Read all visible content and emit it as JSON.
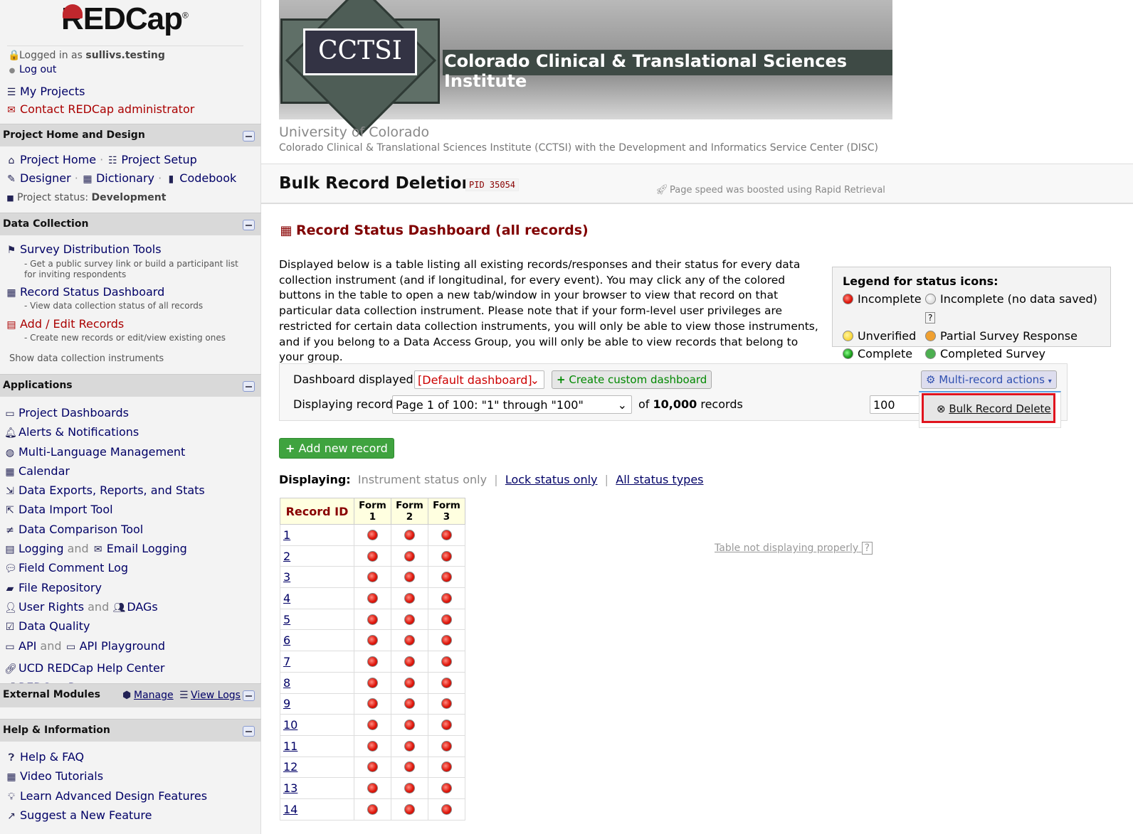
{
  "sidebar": {
    "logo": "REDCap",
    "logo_mark": "®",
    "logged_in_prefix": "Logged in as",
    "username": "sullivs.testing",
    "logout": "Log out",
    "my_projects": "My Projects",
    "contact": "Contact REDCap administrator",
    "sections": {
      "design": {
        "title": "Project Home and Design",
        "project_home": "Project Home",
        "project_setup": "Project Setup",
        "designer": "Designer",
        "dictionary": "Dictionary",
        "codebook": "Codebook",
        "status_label": "Project status:",
        "status_value": "Development"
      },
      "collection": {
        "title": "Data Collection",
        "survey": "Survey Distribution Tools",
        "survey_desc": "- Get a public survey link or build a participant list for inviting respondents",
        "rsd": "Record Status Dashboard",
        "rsd_desc": "- View data collection status of all records",
        "add_edit": "Add / Edit Records",
        "add_edit_desc": "- Create new records or edit/view existing ones",
        "show_instruments": "Show data collection instruments"
      },
      "applications": {
        "title": "Applications",
        "items": [
          "Project Dashboards",
          "Alerts & Notifications",
          "Multi-Language Management",
          "Calendar",
          "Data Exports, Reports, and Stats",
          "Data Import Tool",
          "Data Comparison Tool"
        ],
        "logging": "Logging",
        "and": "and",
        "email_logging": "Email Logging",
        "field_comment": "Field Comment Log",
        "file_repo": "File Repository",
        "user_rights": "User Rights",
        "dags": "DAGs",
        "data_quality": "Data Quality",
        "api": "API",
        "api_playground": "API Playground",
        "help_center": "UCD REDCap Help Center",
        "resources": "REDCap Resources"
      },
      "external": {
        "title": "External Modules",
        "manage": "Manage",
        "view_logs": "View Logs"
      },
      "help": {
        "title": "Help & Information",
        "items": [
          "Help & FAQ",
          "Video Tutorials",
          "Learn Advanced Design Features",
          "Suggest a New Feature"
        ]
      }
    }
  },
  "banner": {
    "acronym": "CCTSI",
    "name": "Colorado Clinical & Translational Sciences Institute",
    "institution": "University of Colorado",
    "subtitle": "Colorado Clinical & Translational Sciences Institute (CCTSI) with the Development and Informatics Service Center (DISC)"
  },
  "header": {
    "title": "Bulk Record Deletion",
    "pid": "PID 35054",
    "speed_note": "Page speed was boosted using Rapid Retrieval"
  },
  "main": {
    "dashboard_title": "Record Status Dashboard (all records)",
    "intro": "Displayed below is a table listing all existing records/responses and their status for every data collection instrument (and if longitudinal, for every event). You may click any of the colored buttons in the table to open a new tab/window in your browser to view that record on that particular data collection instrument. Please note that if your form-level user privileges are restricted for certain data collection instruments, you will only be able to view those instruments, and if you belong to a Data Access Group, you will only be able to view records that belong to your group.",
    "legend": {
      "title": "Legend for status icons:",
      "incomplete": "Incomplete",
      "incomplete_nodata": "Incomplete (no data saved)",
      "help": "?",
      "unverified": "Unverified",
      "partial": "Partial Survey Response",
      "complete": "Complete",
      "completed_survey": "Completed Survey Response"
    },
    "dashboard_label": "Dashboard displayed:",
    "dashboard_value": "[Default dashboard]",
    "create_custom": "Create custom dashboard",
    "multi_actions": "Multi-record actions",
    "displaying_label": "Displaying record",
    "page_value": "Page 1 of 100: \"1\" through \"100\"",
    "of": "of",
    "total": "10,000",
    "records": "records",
    "per_page": "100",
    "bulk_delete": "Bulk Record Delete",
    "add_record": "Add new record",
    "displaying": "Displaying:",
    "instrument_only": "Instrument status only",
    "lock_only": "Lock status only",
    "all_types": "All status types",
    "table_help": "Table not displaying properly",
    "table_help_q": "?",
    "table": {
      "headers": [
        "Record ID",
        "Form 1",
        "Form 2",
        "Form 3"
      ],
      "rows": [
        "1",
        "2",
        "3",
        "4",
        "5",
        "6",
        "7",
        "8",
        "9",
        "10",
        "11",
        "12",
        "13",
        "14"
      ],
      "status": "Incomplete"
    }
  },
  "colors": {
    "accent": "#800000",
    "link": "#000066",
    "highlight": "#e0141e",
    "add_button": "#3fa33f"
  }
}
